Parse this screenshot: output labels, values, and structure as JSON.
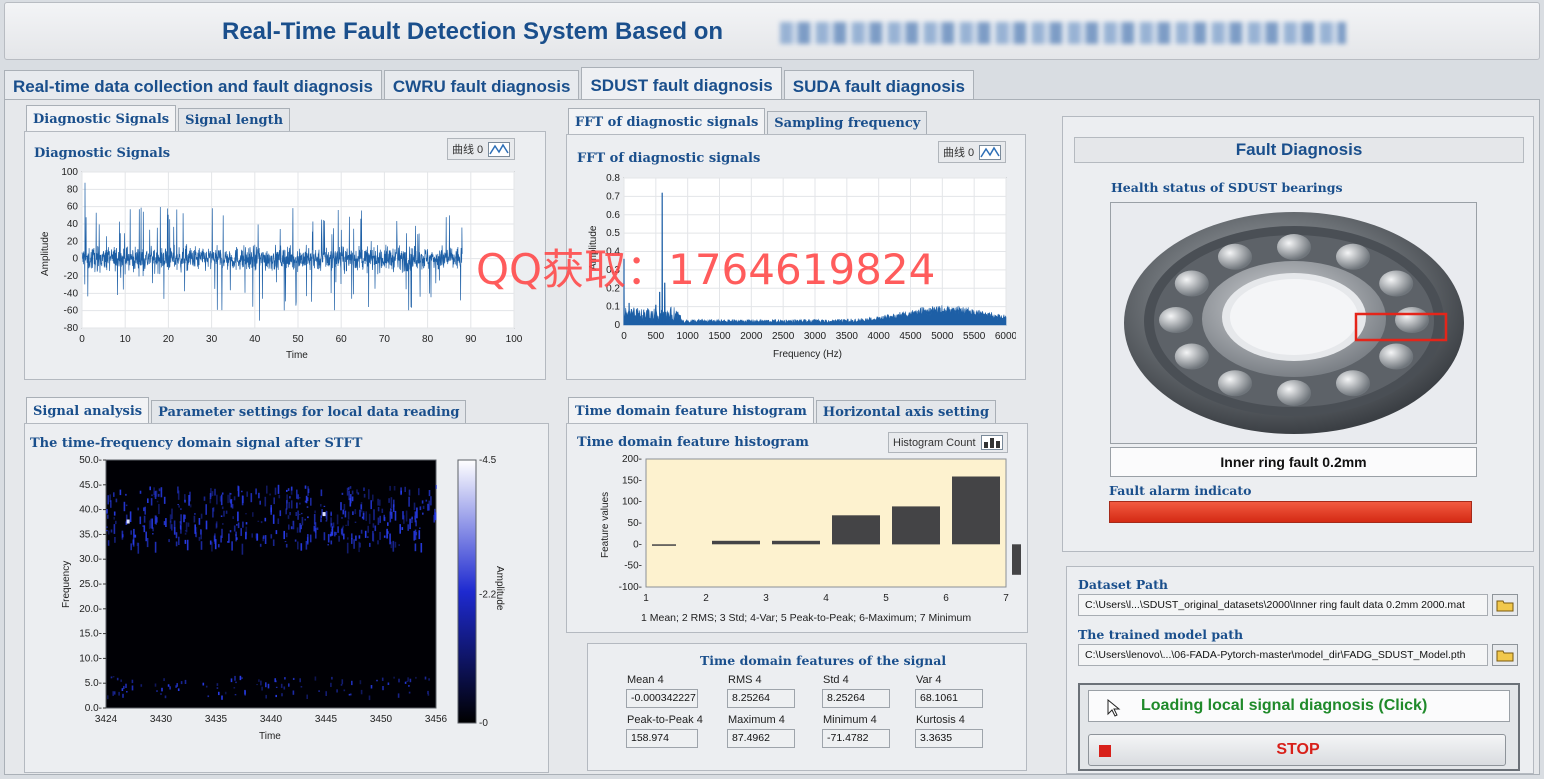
{
  "app": {
    "title": "Real-Time Fault Detection System Based on",
    "title_obscured": "Few-Shot Adversarial Domain Generalization"
  },
  "main_tabs": [
    {
      "label": "Real-time data collection and fault diagnosis",
      "active": false
    },
    {
      "label": "CWRU fault diagnosis",
      "active": false
    },
    {
      "label": "SDUST fault diagnosis",
      "active": true
    },
    {
      "label": "SUDA fault diagnosis",
      "active": false
    }
  ],
  "diag_panel": {
    "tabs": [
      "Diagnostic Signals",
      "Signal length"
    ],
    "label": "Diagnostic Signals",
    "legend": "曲线 0",
    "ylabel": "Amplitude",
    "xlabel": "Time"
  },
  "fft_panel": {
    "tabs": [
      "FFT of diagnostic signals",
      "Sampling frequency"
    ],
    "label": "FFT of diagnostic signals",
    "legend": "曲线 0",
    "ylabel": "Amplitude",
    "xlabel": "Frequency (Hz)"
  },
  "stft_panel": {
    "tabs": [
      "Signal analysis",
      "Parameter settings for local data reading"
    ],
    "label": "The time-frequency domain signal after STFT",
    "ylabel": "Frequency",
    "xlabel": "Time",
    "colorbar_label": "Amplitude",
    "colorbar_ticks": [
      "4.5",
      "2.2",
      "0"
    ]
  },
  "hist_panel": {
    "tabs": [
      "Time domain feature histogram",
      "Horizontal axis setting"
    ],
    "label": "Time domain feature histogram",
    "legend": "Histogram Count",
    "ylabel": "Feature values",
    "caption": "1 Mean;  2 RMS;  3 Std;  4-Var;  5 Peak-to-Peak;  6-Maximum;  7 Minimum"
  },
  "features": {
    "title": "Time domain features of the signal",
    "items": [
      {
        "label": "Mean 4",
        "value": "-0.000342227"
      },
      {
        "label": "RMS 4",
        "value": "8.25264"
      },
      {
        "label": "Std 4",
        "value": "8.25264"
      },
      {
        "label": "Var 4",
        "value": "68.1061"
      },
      {
        "label": "Peak-to-Peak 4",
        "value": "158.974"
      },
      {
        "label": "Maximum 4",
        "value": "87.4962"
      },
      {
        "label": "Minimum 4",
        "value": "-71.4782"
      },
      {
        "label": "Kurtosis 4",
        "value": "3.3635"
      }
    ]
  },
  "fault": {
    "title": "Fault Diagnosis",
    "health_label": "Health status of SDUST bearings",
    "result": "Inner ring fault 0.2mm",
    "alarm_label": "Fault alarm indicato",
    "alarm_color": "#e8321e"
  },
  "paths": {
    "dataset_label": "Dataset Path",
    "dataset_value": "C:\\Users\\l...\\SDUST_original_datasets\\2000\\Inner ring fault data 0.2mm 2000.mat",
    "model_label": "The trained model path",
    "model_value": "C:\\Users\\lenovo\\...\\06-FADA-Pytorch-master\\model_dir\\FADG_SDUST_Model.pth"
  },
  "buttons": {
    "load": "Loading local signal diagnosis  (Click)",
    "stop": "STOP"
  },
  "watermark": "QQ获取：1764619824",
  "chart_data": [
    {
      "type": "line",
      "title": "Diagnostic Signals",
      "xlabel": "Time",
      "ylabel": "Amplitude",
      "xlim": [
        0,
        100
      ],
      "ylim": [
        -80,
        100
      ],
      "x_ticks": [
        0,
        10,
        20,
        30,
        40,
        50,
        60,
        70,
        80,
        90,
        100
      ],
      "y_ticks": [
        -80,
        -60,
        -40,
        -20,
        0,
        20,
        40,
        60,
        80,
        100
      ],
      "series": [
        {
          "note_signal_extent": [
            0,
            88
          ],
          "typical_band": [
            -30,
            30
          ],
          "max": 87.5,
          "min": -71.5
        }
      ]
    },
    {
      "type": "line",
      "title": "FFT of diagnostic signals",
      "xlabel": "Frequency (Hz)",
      "ylabel": "Amplitude",
      "xlim": [
        0,
        6000
      ],
      "ylim": [
        0,
        0.8
      ],
      "x_ticks": [
        0,
        500,
        1000,
        1500,
        2000,
        2500,
        3000,
        3500,
        4000,
        4500,
        5000,
        5500,
        6000
      ],
      "y_ticks": [
        0,
        0.1,
        0.2,
        0.3,
        0.4,
        0.5,
        0.6,
        0.7,
        0.8
      ],
      "peaks": [
        {
          "x": 0,
          "y": 0.36
        },
        {
          "x": 80,
          "y": 0.12
        },
        {
          "x": 500,
          "y": 0.11
        },
        {
          "x": 560,
          "y": 0.18
        },
        {
          "x": 600,
          "y": 0.72
        },
        {
          "x": 640,
          "y": 0.23
        }
      ],
      "broad_hump": {
        "x": [
          3000,
          6000
        ],
        "peak_y": 0.1,
        "peak_x": 5050
      }
    },
    {
      "type": "heatmap",
      "title": "The time-frequency domain signal after STFT",
      "xlabel": "Time",
      "ylabel": "Frequency",
      "x_ticks": [
        "3424",
        "3430",
        "3435",
        "3440",
        "3445",
        "3450",
        "3456"
      ],
      "y_ticks": [
        "0.0",
        "5.0",
        "10.0",
        "15.0",
        "20.0",
        "25.0",
        "30.0",
        "35.0",
        "40.0",
        "45.0",
        "50.0"
      ],
      "ylim": [
        0,
        50
      ],
      "colorbar": {
        "range": [
          0,
          4.5
        ],
        "label": "Amplitude"
      }
    },
    {
      "type": "bar",
      "title": "Time domain feature histogram",
      "ylabel": "Feature values",
      "categories": [
        "1",
        "2",
        "3",
        "4",
        "5",
        "6",
        "7"
      ],
      "values": [
        0,
        8.25,
        8.25,
        68.1,
        89,
        159,
        -71.5
      ],
      "ylim": [
        -100,
        200
      ],
      "y_ticks": [
        -100,
        -50,
        0,
        50,
        100,
        150,
        200
      ]
    }
  ]
}
